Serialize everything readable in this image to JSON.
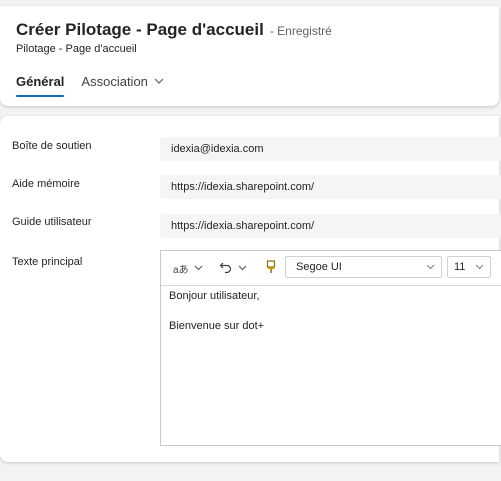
{
  "header": {
    "title": "Créer Pilotage - Page d'accueil",
    "saved_status": "- Enregistré",
    "subtitle": "Pilotage - Page d'accueil",
    "tabs": [
      {
        "label": "Général"
      },
      {
        "label": "Association"
      }
    ]
  },
  "form": {
    "fields": [
      {
        "label": "Boîte de soutien",
        "value": "idexia@idexia.com"
      },
      {
        "label": "Aide mémoire",
        "value": "https://idexia.sharepoint.com/"
      },
      {
        "label": "Guide utilisateur",
        "value": "https://idexia.sharepoint.com/"
      }
    ],
    "main_text": {
      "label": "Texte principal",
      "toolbar": {
        "language_glyph": "aあ",
        "font": "Segoe UI",
        "size": "11"
      },
      "content": [
        "Bonjour utilisateur,",
        "Bienvenue sur dot+"
      ]
    }
  },
  "colors": {
    "accent": "#0f6cbd",
    "background": "#f3f3f3",
    "field_background": "#f5f5f5"
  }
}
